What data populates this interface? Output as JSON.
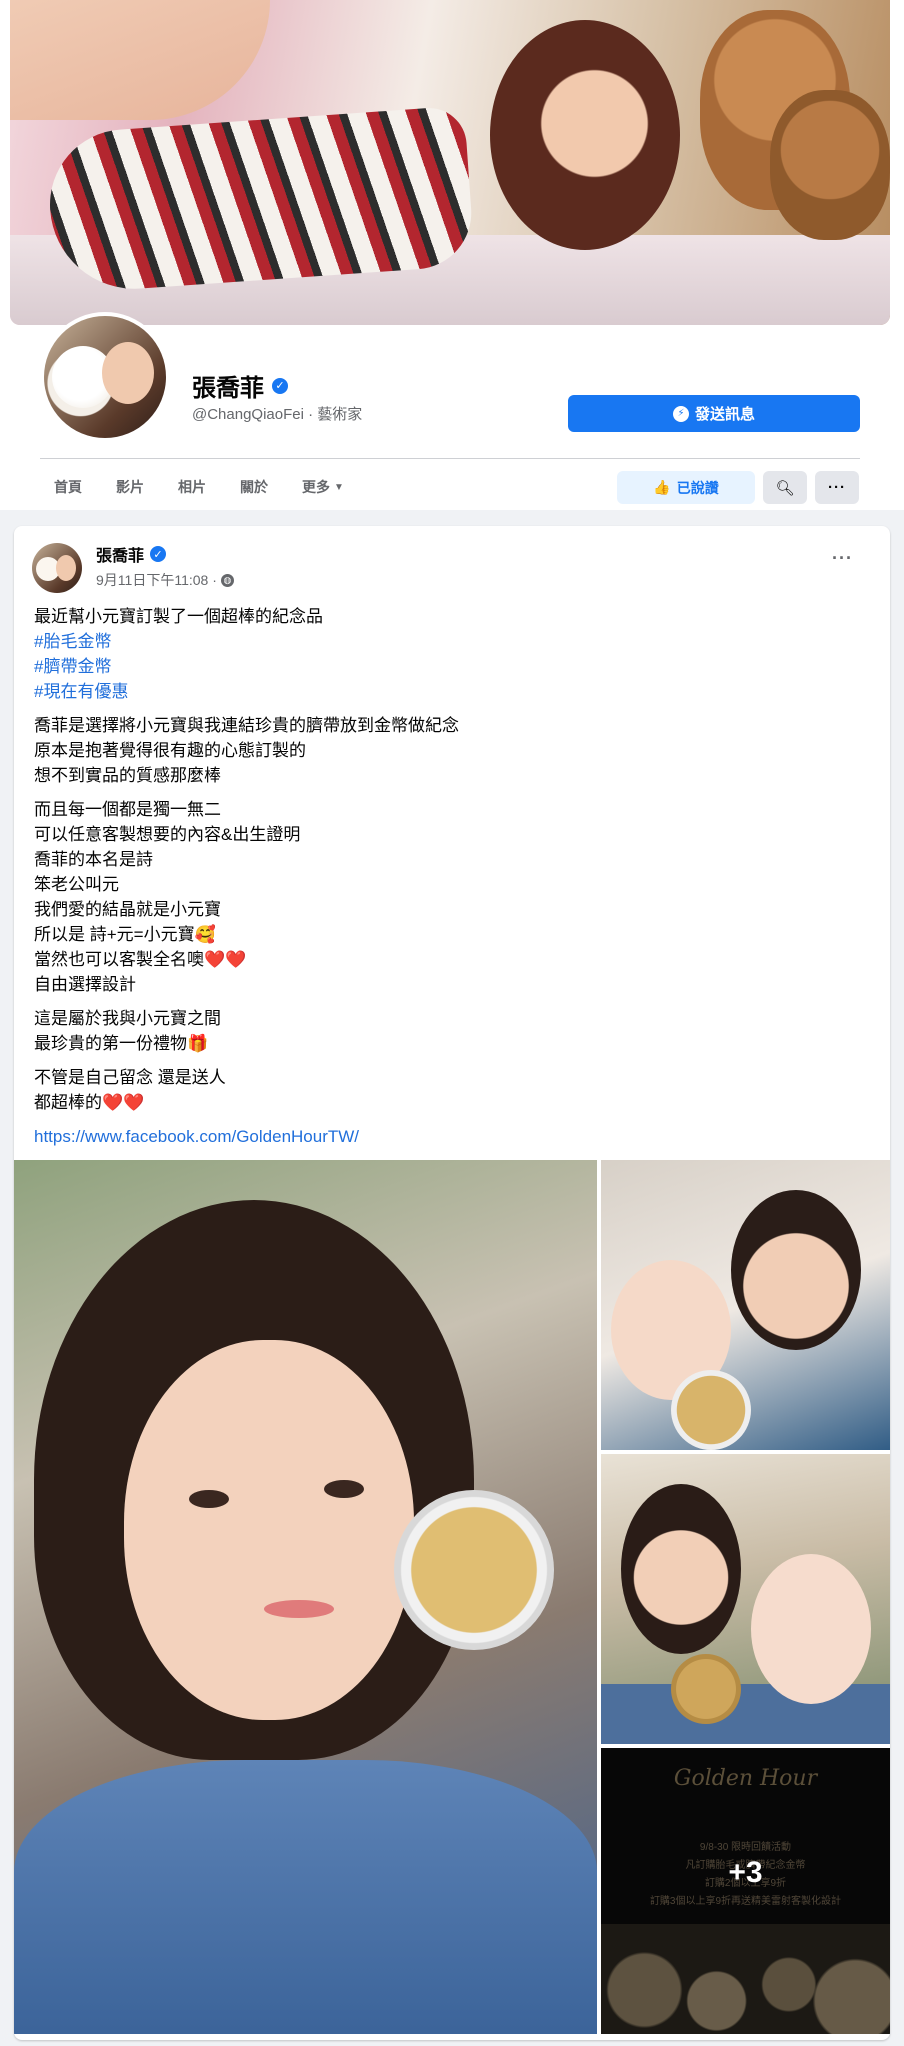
{
  "profile": {
    "name": "張喬菲",
    "handle": "@ChangQiaoFei · 藝術家",
    "message_button": "發送訊息",
    "liked_button": "已說讚",
    "search_icon": "search-icon",
    "more_icon": "more-icon",
    "tabs": [
      "首頁",
      "影片",
      "相片",
      "關於",
      "更多"
    ]
  },
  "post": {
    "author": "張喬菲",
    "timestamp": "9月11日下午11:08 ·",
    "paragraphs": [
      {
        "lines": [
          "最近幫小元寶訂製了一個超棒的紀念品"
        ],
        "hashtags": [
          "#胎毛金幣",
          "#臍帶金幣",
          "#現在有優惠"
        ]
      },
      {
        "lines": [
          "喬菲是選擇將小元寶與我連結珍貴的臍帶放到金幣做紀念",
          "原本是抱著覺得很有趣的心態訂製的",
          "想不到實品的質感那麼棒"
        ]
      },
      {
        "lines": [
          "而且每一個都是獨一無二",
          "可以任意客製想要的內容&出生證明",
          "喬菲的本名是詩",
          "笨老公叫元",
          "我們愛的結晶就是小元寶",
          "所以是 詩+元=小元寶🥰",
          "當然也可以客製全名噢❤️❤️",
          "自由選擇設計"
        ]
      },
      {
        "lines": [
          "這是屬於我與小元寶之間",
          "最珍貴的第一份禮物🎁"
        ]
      },
      {
        "lines": [
          "不管是自己留念 還是送人",
          "都超棒的❤️❤️"
        ]
      }
    ],
    "link": "https://www.facebook.com/GoldenHourTW/",
    "photos": {
      "promo_logo": "Golden Hour",
      "promo_lines": [
        "9/8-30 限時回饋活動",
        "凡訂購胎毛或臍帶紀念金幣",
        "訂購2個以上享9折",
        "訂購3個以上享9折再送精美雷射客製化設計"
      ],
      "more_count": "+3"
    }
  },
  "colors": {
    "accent": "#1877f2",
    "link": "#216fdb",
    "page_background": "#f0f2f5"
  }
}
